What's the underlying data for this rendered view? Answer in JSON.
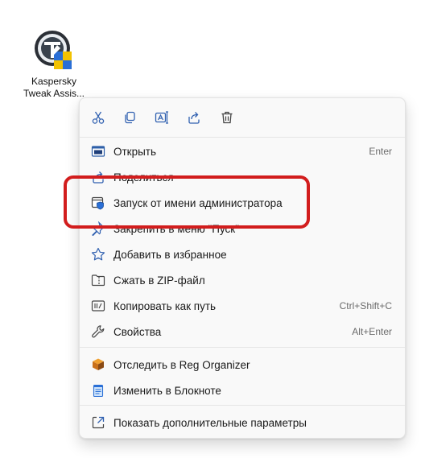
{
  "desktop_icon": {
    "label_line1": "Kaspersky",
    "label_line2": "Tweak Assis..."
  },
  "context_menu": {
    "quick_actions": [
      {
        "name": "cut",
        "icon": "scissors-icon"
      },
      {
        "name": "copy",
        "icon": "copy-icon"
      },
      {
        "name": "rename",
        "icon": "rename-icon"
      },
      {
        "name": "share",
        "icon": "share-icon"
      },
      {
        "name": "delete",
        "icon": "trash-icon"
      }
    ],
    "items": [
      {
        "label": "Открыть",
        "shortcut": "Enter",
        "icon": "open-window-icon"
      },
      {
        "label": "Поделиться",
        "shortcut": "",
        "icon": "share-icon"
      },
      {
        "label": "Запуск от имени администратора",
        "shortcut": "",
        "icon": "uac-shield-icon"
      },
      {
        "label": "Закрепить в меню \"Пуск\"",
        "shortcut": "",
        "icon": "pin-icon"
      },
      {
        "label": "Добавить в избранное",
        "shortcut": "",
        "icon": "star-icon"
      },
      {
        "label": "Сжать в ZIP-файл",
        "shortcut": "",
        "icon": "zip-folder-icon"
      },
      {
        "label": "Копировать как путь",
        "shortcut": "Ctrl+Shift+C",
        "icon": "copy-path-icon"
      },
      {
        "label": "Свойства",
        "shortcut": "Alt+Enter",
        "icon": "wrench-icon"
      },
      {
        "label": "Отследить в Reg Organizer",
        "shortcut": "",
        "icon": "reg-organizer-icon"
      },
      {
        "label": "Изменить в Блокноте",
        "shortcut": "",
        "icon": "notepad-icon"
      },
      {
        "label": "Показать дополнительные параметры",
        "shortcut": "",
        "icon": "more-options-icon"
      }
    ]
  },
  "colors": {
    "accent": "#0067c0",
    "highlight_border": "#d21d1d",
    "menu_bg": "#f9f9f9"
  }
}
